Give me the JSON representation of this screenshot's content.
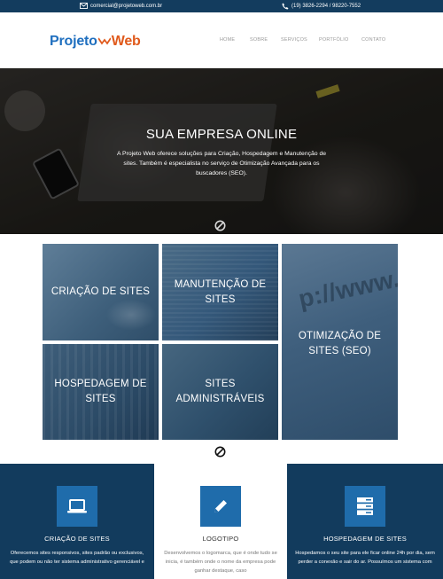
{
  "topbar": {
    "email": "comercial@projetoweb.com.br",
    "phone": "(19) 3826-2294 / 98220-7552"
  },
  "logo": {
    "part1": "Projeto",
    "part2": "Web"
  },
  "nav": {
    "items": [
      "HOME",
      "SOBRE",
      "SERVIÇOS",
      "PORTFÓLIO",
      "CONTATO"
    ]
  },
  "hero": {
    "title": "SUA EMPRESA ONLINE",
    "subtitle": "A Projeto Web oferece soluções para Criação, Hospedagem e Manutenção de sites. Também é especialista no serviço de Otimização Avançada para os buscadores (SEO)."
  },
  "services": {
    "tiles": [
      "CRIAÇÃO DE SITES",
      "MANUTENÇÃO DE SITES",
      "OTIMIZAÇÃO DE SITES (SEO)",
      "HOSPEDAGEM DE SITES",
      "SITES ADMINISTRÁVEIS"
    ]
  },
  "cards": [
    {
      "icon": "laptop-icon",
      "title": "CRIAÇÃO DE SITES",
      "text": "Oferecemos sites responsivos, sites padrão ou exclusivos, que podem ou não ter sistema administrativo gerenciável e"
    },
    {
      "icon": "pencil-icon",
      "title": "LOGOTIPO",
      "text": "Desenvolvemos o logomarca, que é onde tudo se inicia, é também onde o nome da empresa pode ganhar destaque, caso"
    },
    {
      "icon": "server-icon",
      "title": "HOSPEDAGEM DE SITES",
      "text": "Hospedamos o seu site para ele ficar online 24h por dia, sem perder a conexão e sair do ar. Possuímos um sistema com"
    }
  ],
  "colors": {
    "topbar": "#133c5e",
    "card_dark": "#123b5d",
    "accent_blue": "#1f6cab",
    "logo_blue": "#1f6fbf",
    "logo_orange": "#e05a1c"
  }
}
